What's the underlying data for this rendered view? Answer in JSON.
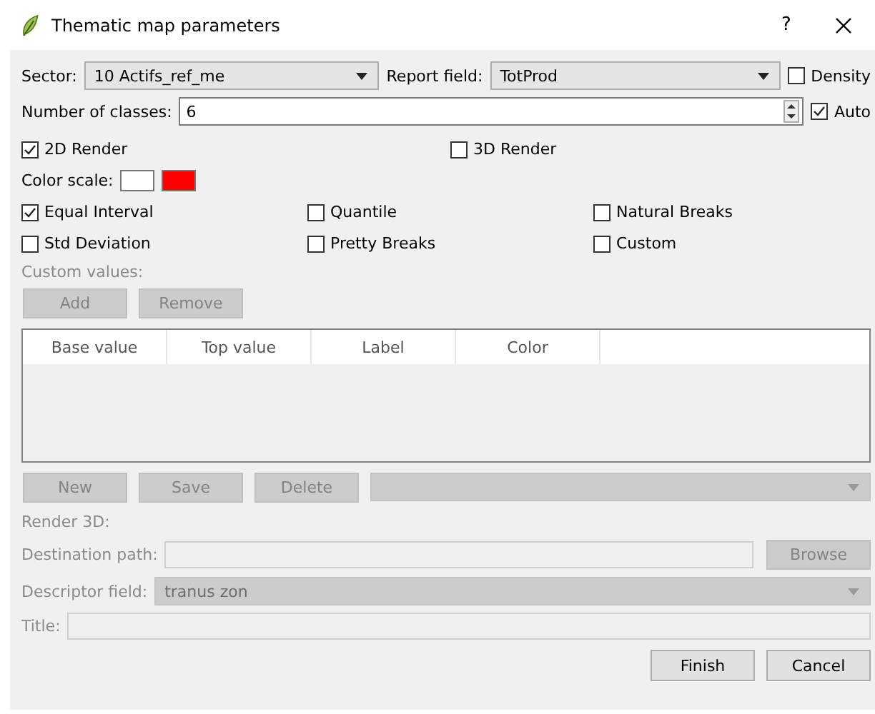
{
  "window": {
    "title": "Thematic map parameters",
    "help": "?"
  },
  "sector": {
    "label": "Sector:",
    "value": "10 Actifs_ref_me"
  },
  "report_field": {
    "label": "Report field:",
    "value": "TotProd"
  },
  "density": {
    "label": "Density",
    "checked": false
  },
  "classes": {
    "label": "Number of classes:",
    "value": "6"
  },
  "auto": {
    "label": "Auto",
    "checked": true
  },
  "render_options": [
    {
      "label": "2D Render",
      "checked": true
    },
    {
      "label": "3D Render",
      "checked": false
    }
  ],
  "color_scale": {
    "label": "Color scale:",
    "colors": [
      {
        "color": "#ffffff"
      },
      {
        "color": "#ff0000"
      }
    ]
  },
  "methods": [
    {
      "label": "Equal Interval",
      "checked": true
    },
    {
      "label": "Quantile",
      "checked": false
    },
    {
      "label": "Natural Breaks",
      "checked": false
    },
    {
      "label": "Std Deviation",
      "checked": false
    },
    {
      "label": "Pretty Breaks",
      "checked": false
    },
    {
      "label": "Custom",
      "checked": false
    }
  ],
  "custom_values": {
    "label": "Custom values:",
    "disabled": true,
    "buttons": [
      {
        "label": "Add",
        "disabled": true
      },
      {
        "label": "Remove",
        "disabled": true
      }
    ]
  },
  "table": {
    "columns": [
      "Base value",
      "Top value",
      "Label",
      "Color"
    ]
  },
  "editor_buttons": [
    {
      "label": "New",
      "disabled": true
    },
    {
      "label": "Save",
      "disabled": true
    },
    {
      "label": "Delete",
      "disabled": true
    }
  ],
  "editor_combo": {
    "disabled": true
  },
  "render_3d": {
    "label": "Render 3D:",
    "destination": {
      "label": "Destination path:"
    },
    "browse": {
      "label": "Browse",
      "disabled": true
    },
    "descriptor": {
      "label": "Descriptor field:",
      "value": "tranus zon"
    },
    "title": {
      "label": "Title:"
    }
  },
  "footer_buttons": [
    {
      "label": "Finish"
    },
    {
      "label": "Cancel"
    }
  ]
}
